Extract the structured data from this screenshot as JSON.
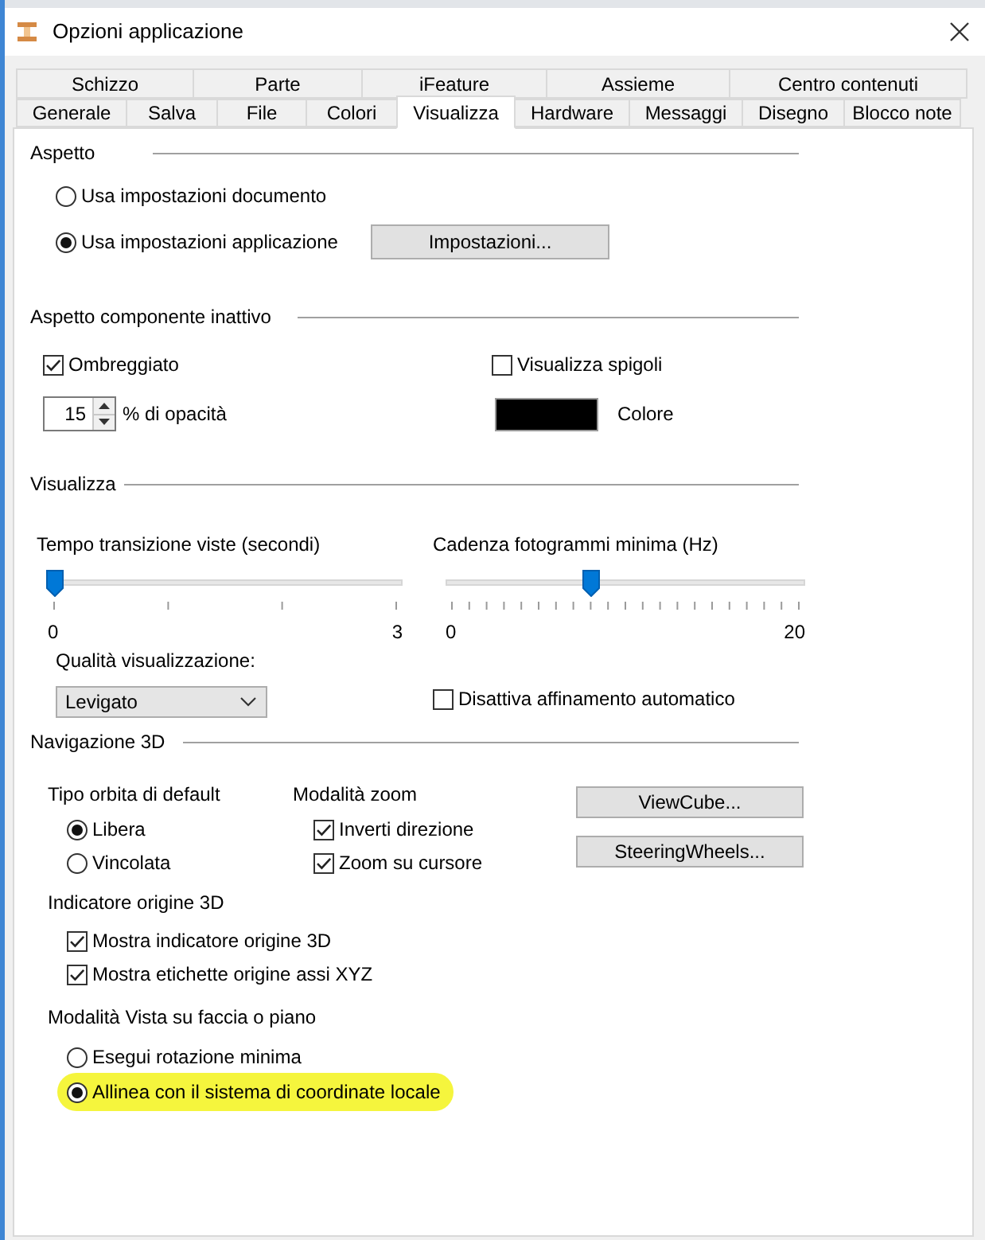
{
  "window": {
    "title": "Opzioni applicazione"
  },
  "tab_rows": [
    [
      {
        "label": "Schizzo",
        "selected": false
      },
      {
        "label": "Parte",
        "selected": false
      },
      {
        "label": "iFeature",
        "selected": false
      },
      {
        "label": "Assieme",
        "selected": false
      },
      {
        "label": "Centro contenuti",
        "selected": false
      }
    ],
    [
      {
        "label": "Generale",
        "selected": false
      },
      {
        "label": "Salva",
        "selected": false
      },
      {
        "label": "File",
        "selected": false
      },
      {
        "label": "Colori",
        "selected": false
      },
      {
        "label": "Visualizza",
        "selected": true
      },
      {
        "label": "Hardware",
        "selected": false
      },
      {
        "label": "Messaggi",
        "selected": false
      },
      {
        "label": "Disegno",
        "selected": false
      },
      {
        "label": "Blocco note",
        "selected": false
      }
    ]
  ],
  "appearance": {
    "heading": "Aspetto",
    "options": [
      {
        "label": "Usa impostazioni documento",
        "selected": false
      },
      {
        "label": "Usa impostazioni applicazione",
        "selected": true
      }
    ],
    "settings_button": "Impostazioni..."
  },
  "inactive_component": {
    "heading": "Aspetto componente inattivo",
    "shaded": {
      "label": "Ombreggiato",
      "checked": true
    },
    "show_edges": {
      "label": "Visualizza spigoli",
      "checked": false
    },
    "opacity": {
      "value": "15",
      "label": "% di opacità"
    },
    "color": {
      "label": "Colore"
    }
  },
  "display": {
    "heading": "Visualizza",
    "sliders": [
      {
        "label": "Tempo transizione viste (secondi)",
        "level": 0,
        "min_label": "0",
        "max_label": "3"
      },
      {
        "label": "Cadenza fotogrammi minima (Hz)",
        "level": 0.4,
        "min_label": "0",
        "max_label": "20"
      }
    ],
    "quality": {
      "label": "Qualità visualizzazione:",
      "value": "Levigato"
    },
    "disable_auto_refine": {
      "label": "Disattiva affinamento automatico",
      "checked": false
    }
  },
  "navigation_3d": {
    "heading": "Navigazione 3D",
    "orbit_type": {
      "label": "Tipo orbita di default",
      "options": [
        {
          "label": "Libera",
          "selected": true
        },
        {
          "label": "Vincolata",
          "selected": false
        }
      ]
    },
    "zoom_mode": {
      "label": "Modalità zoom",
      "options": [
        {
          "label": "Inverti direzione",
          "checked": true
        },
        {
          "label": "Zoom su cursore",
          "checked": true
        }
      ]
    },
    "buttons": [
      "ViewCube...",
      "SteeringWheels..."
    ],
    "origin_indicator": {
      "label": "Indicatore origine 3D",
      "options": [
        {
          "label": "Mostra indicatore origine 3D",
          "checked": true
        },
        {
          "label": "Mostra etichette origine assi XYZ",
          "checked": true
        }
      ]
    },
    "view_mode": {
      "label": "Modalità Vista su faccia o piano",
      "options": [
        {
          "label": "Esegui rotazione minima",
          "selected": false,
          "highlighted": false
        },
        {
          "label": "Allinea con il sistema di coordinate locale",
          "selected": true,
          "highlighted": true
        }
      ]
    }
  }
}
